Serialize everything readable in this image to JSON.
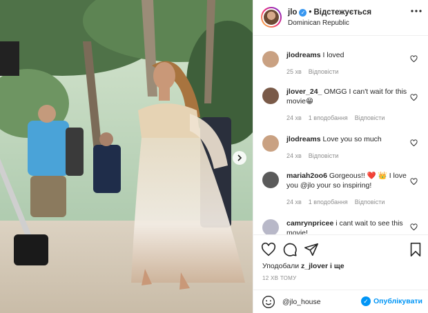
{
  "header": {
    "username": "jlo",
    "verified_mark": "✓",
    "separator": "•",
    "follow_status": "Відстежується",
    "location": "Dominican Republic",
    "more_icon": "more-horizontal-icon"
  },
  "comments": [
    {
      "user": "jlodreams",
      "text": "I loved",
      "time": "25 хв",
      "reply": "Відповісти",
      "likes": "",
      "avatar_color": "#c9a182"
    },
    {
      "user": "jlover_24_",
      "text": "OMGG I can't wait for this movie😁",
      "time": "24 хв",
      "likes": "1 вподобання",
      "reply": "Відповісти",
      "avatar_color": "#7a5a48"
    },
    {
      "user": "jlodreams",
      "text": "Love you so much",
      "time": "24 хв",
      "reply": "Відповісти",
      "likes": "",
      "avatar_color": "#c9a182"
    },
    {
      "user": "mariah2oo6",
      "text": "Gorgeous!! ❤️ 👑 I love you @jlo your so inspiring!",
      "time": "24 хв",
      "likes": "1 вподобання",
      "reply": "Відповісти",
      "avatar_color": "#5a5a5a"
    },
    {
      "user": "camrynpricee",
      "text": "i cant wait to see this movie!",
      "time": "",
      "likes": "",
      "reply": "",
      "avatar_color": "#b8b8c8"
    }
  ],
  "actions": {
    "liked_prefix": "Уподобали",
    "liked_user": "z_jlover",
    "liked_suffix": "і ще",
    "time_ago": "12 ХВ ТОМУ"
  },
  "add_comment": {
    "value": "@jlo_house",
    "publish_label": "Опублікувати"
  },
  "colors": {
    "accent": "#0095f6",
    "verified": "#3897f0",
    "meta": "#8e8e8e",
    "border": "#efefef"
  }
}
